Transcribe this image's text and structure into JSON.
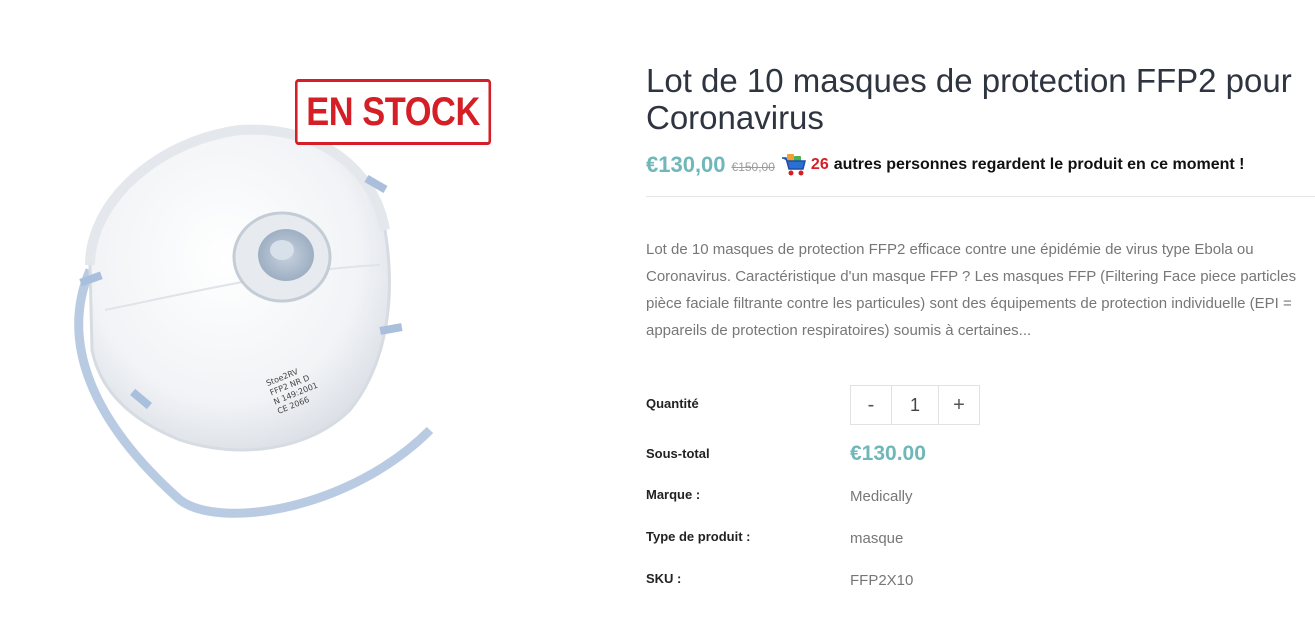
{
  "badge": {
    "stock_label": "EN STOCK"
  },
  "mask_print": {
    "lines": [
      "Stoe2RV",
      "FFP2 NR D",
      "N 149:2001",
      "CE 2066"
    ]
  },
  "product": {
    "title_line1": "Lot de 10 masques de protection FFP2 pour",
    "title_line2": "Coronavirus",
    "price": "€130,00",
    "old_price": "€150,00",
    "watch_count": "26",
    "watch_text": "autres personnes regardent le produit en ce moment !",
    "description_lines": [
      "Lot de 10 masques de protection FFP2 efficace contre une épidémie de virus type Ebola ou",
      "Coronavirus.  Caractéristique d'un masque FFP ? Les masques FFP (Filtering Face piece particles",
      "pièce faciale filtrante contre les particules) sont des équipements de protection individuelle (EPI =",
      "appareils de protection respiratoires) soumis à certaines..."
    ]
  },
  "specs": {
    "quantity_label": "Quantité",
    "quantity_value": "1",
    "minus_label": "-",
    "plus_label": "+",
    "subtotal_label": "Sous-total",
    "subtotal_value": "€130.00",
    "brand_label": "Marque :",
    "brand_value": "Medically",
    "type_label": "Type de produit :",
    "type_value": "masque",
    "sku_label": "SKU :",
    "sku_value": "FFP2X10"
  },
  "icons": {
    "watchers": "shopping-cart-icon"
  },
  "colors": {
    "accent": "#6fb7b8",
    "alert": "#d41f26",
    "title": "#2f3540",
    "muted": "#777777"
  }
}
